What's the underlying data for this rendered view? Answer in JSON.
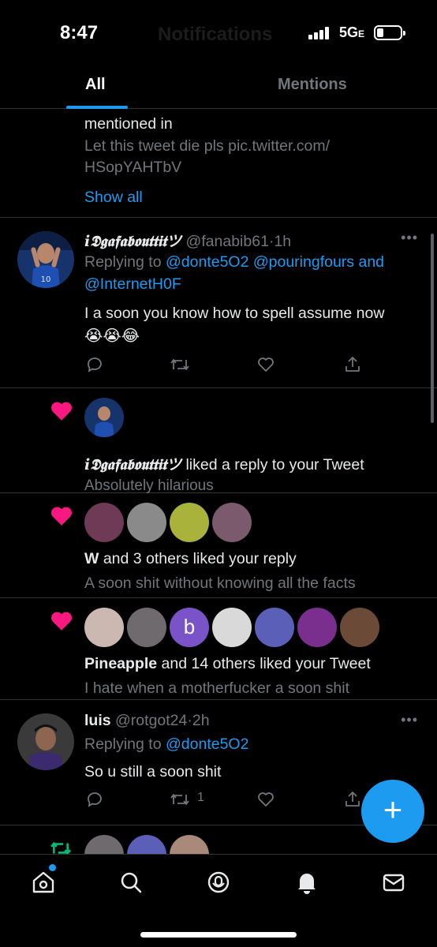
{
  "status_bar": {
    "time": "8:47",
    "network": "5G",
    "network_suffix": "E",
    "ghost_title": "Notifications"
  },
  "tabs": [
    {
      "label": "All",
      "active": true
    },
    {
      "label": "Mentions",
      "active": false
    }
  ],
  "mention_group": {
    "line1": "mentioned in",
    "preview_line1": "Let this tweet die pls pic.twitter.com/",
    "preview_line2": "HSopYAHTbV",
    "show_all": "Show all"
  },
  "reply_1": {
    "display_name": "i𝕯𝖌𝖆𝖋𝖆𝖇𝖔𝖚𝖙𝖙𝖎𝖙ツ",
    "handle": "@fanabib61",
    "dot": "·",
    "time": "1h",
    "replying_to": "Replying to",
    "mentions_line1": "@donte5O2 @pouringfours and",
    "mentions_line2": "@InternetH0F",
    "text": "I a soon you know how to spell assume now",
    "emoji": "😭😭😂"
  },
  "like_1": {
    "display_name": "i𝕯𝖌𝖆𝖋𝖆𝖇𝖔𝖚𝖙𝖙𝖎𝖙ツ",
    "action": "liked a reply to your Tweet",
    "preview": "Absolutely hilarious"
  },
  "like_2": {
    "name": "W",
    "action": "and 3 others liked your reply",
    "preview": "A soon shit without knowing all the facts"
  },
  "like_3": {
    "name": "Pineapple",
    "action": "and 14 others liked your Tweet",
    "preview": "I hate when a motherfucker a soon shit",
    "letter_avatar": "b"
  },
  "reply_2": {
    "display_name": "luis",
    "handle": "@rotgot24",
    "dot": "·",
    "time": "2h",
    "replying_to": "Replying to",
    "mention": "@donte5O2",
    "text": "So u still a soon shit",
    "retweet_count": "1"
  },
  "fab": {
    "label": "+"
  },
  "colors": {
    "accent": "#1d9bf0",
    "like": "#f91880",
    "retweet": "#00ba7c",
    "background": "#000000",
    "secondary_text": "#71767b"
  },
  "icons": [
    "home-icon",
    "search-icon",
    "spaces-icon",
    "notifications-icon",
    "messages-icon",
    "heart-icon",
    "retweet-icon",
    "reply-icon",
    "share-icon",
    "more-icon"
  ]
}
